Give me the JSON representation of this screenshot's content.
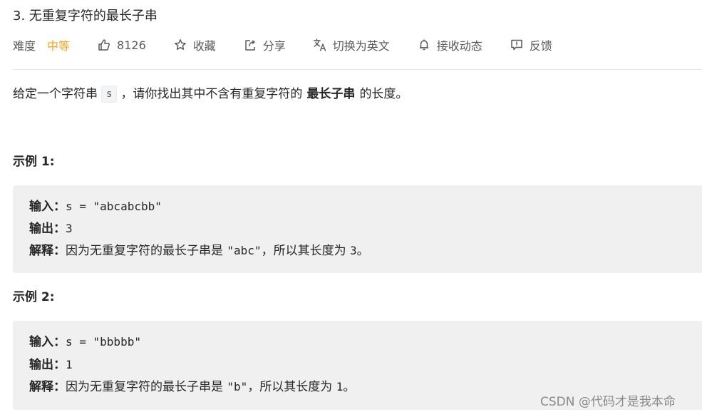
{
  "problem": {
    "title": "3. 无重复字符的最长子串"
  },
  "meta": {
    "difficulty_label": "难度",
    "difficulty_value": "中等",
    "difficulty_color": "#ffa116",
    "likes": "8126",
    "likes_icon": "thumbs-up-icon",
    "favorite_label": "收藏",
    "favorite_icon": "star-icon",
    "share_label": "分享",
    "share_icon": "share-icon",
    "translate_label": "切换为英文",
    "translate_icon": "translate-icon",
    "notify_label": "接收动态",
    "notify_icon": "bell-icon",
    "feedback_label": "反馈",
    "feedback_icon": "feedback-icon"
  },
  "description": {
    "part1": "给定一个字符串",
    "code": "s",
    "part2": "，请你找出其中不含有重复字符的",
    "bold": "最长子串",
    "part3": "的长度。"
  },
  "examples": [
    {
      "heading": "示例 1:",
      "input_label": "输入：",
      "input_value": "s = \"abcabcbb\"",
      "output_label": "输出：",
      "output_value": "3",
      "explain_label": "解释：",
      "explain_text1": "因为无重复字符的最长子串是 ",
      "explain_code": "\"abc\"",
      "explain_text2": "，所以其长度为 ",
      "explain_num": "3",
      "explain_end": "。"
    },
    {
      "heading": "示例 2:",
      "input_label": "输入：",
      "input_value": "s = \"bbbbb\"",
      "output_label": "输出：",
      "output_value": "1",
      "explain_label": "解释：",
      "explain_text1": "因为无重复字符的最长子串是 ",
      "explain_code": "\"b\"",
      "explain_text2": "，所以其长度为 ",
      "explain_num": "1",
      "explain_end": "。"
    }
  ],
  "watermark": "CSDN @代码才是我本命"
}
